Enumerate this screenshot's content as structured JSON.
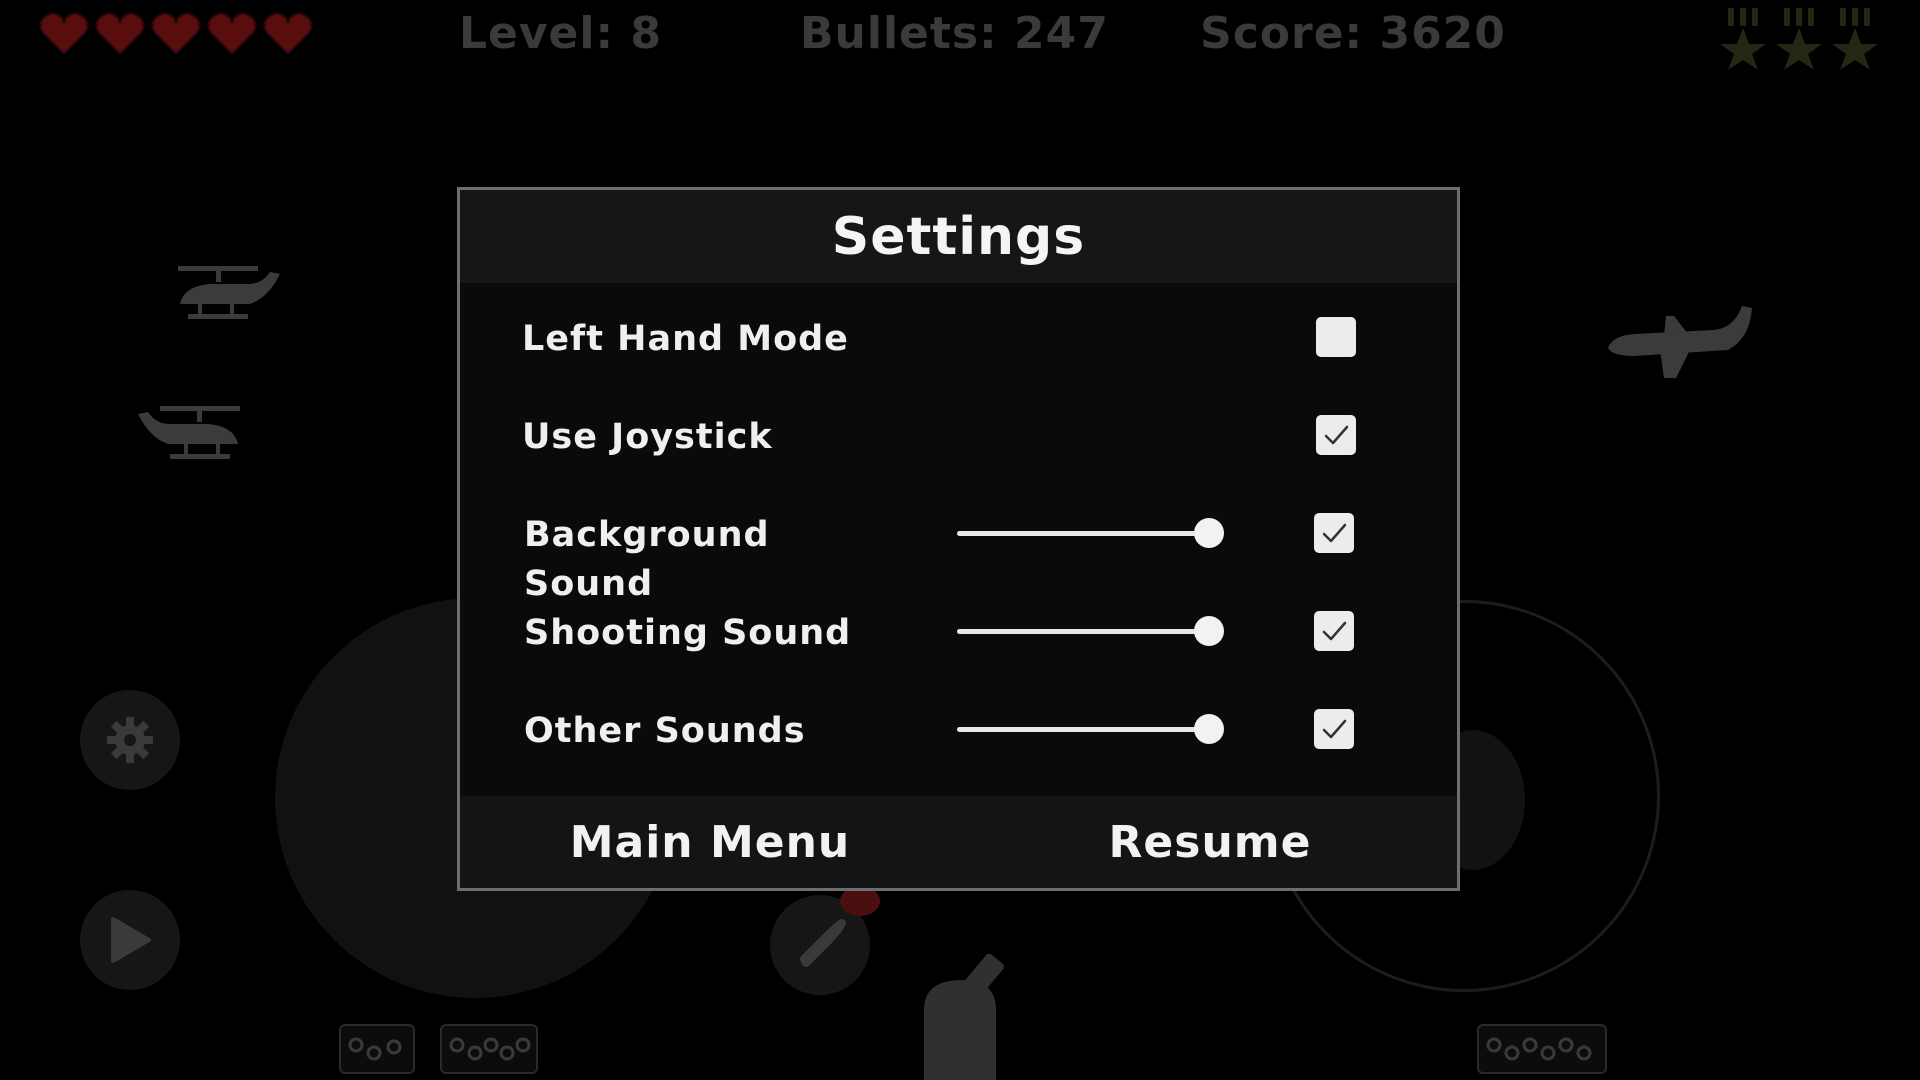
{
  "hud": {
    "lives": 5,
    "level_text": "Level: 8",
    "bullets_text": "Bullets: 247",
    "score_text": "Score: 3620",
    "medals": 3,
    "heart_color": "#5a0d0d",
    "medal_color": "#262614"
  },
  "background": {
    "icons": [
      "helicopter-icon",
      "helicopter-icon",
      "plane-icon",
      "gear-icon",
      "play-icon",
      "bullet-icon",
      "cannon-icon"
    ]
  },
  "settings": {
    "title": "Settings",
    "rows": [
      {
        "label": "Left Hand Mode",
        "checked": false
      },
      {
        "label": "Use Joystick",
        "checked": true
      },
      {
        "label_line1": "Background",
        "label_line2": "Sound",
        "volume": 1.0,
        "checked": true
      },
      {
        "label": "Shooting Sound",
        "volume": 1.0,
        "checked": true
      },
      {
        "label": "Other Sounds",
        "volume": 1.0,
        "checked": true
      }
    ],
    "footer": {
      "main_menu_label": "Main Menu",
      "resume_label": "Resume"
    }
  }
}
